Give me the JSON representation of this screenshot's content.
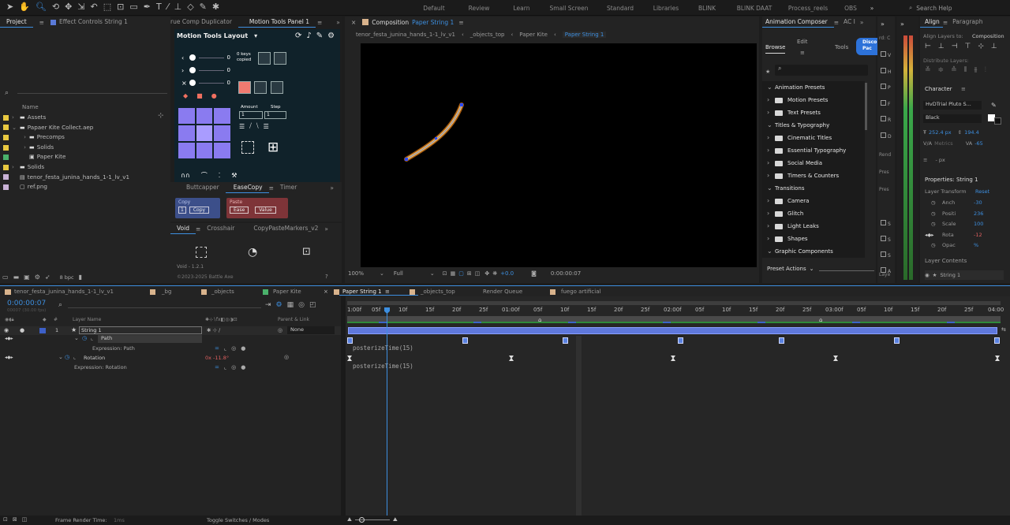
{
  "topbar": {
    "workspaces": [
      "Default",
      "Review",
      "Learn",
      "Small Screen",
      "Standard",
      "Libraries",
      "BLINK",
      "BLINK DAAT",
      "Process_reels",
      "OBS"
    ],
    "search_placeholder": "Search Help"
  },
  "project": {
    "tabs": [
      "Project",
      "Effect Controls String 1"
    ],
    "col_name": "Name",
    "items": [
      {
        "label": "Assets",
        "color": "#e8c840",
        "indent": 0,
        "type": "folder"
      },
      {
        "label": "Papaer Kite Collect.aep",
        "color": "#e8c840",
        "indent": 0,
        "type": "folder"
      },
      {
        "label": "Precomps",
        "color": "#e8c840",
        "indent": 1,
        "type": "folder"
      },
      {
        "label": "Solids",
        "color": "#e8c840",
        "indent": 1,
        "type": "folder"
      },
      {
        "label": "Paper Kite",
        "color": "#4ab16b",
        "indent": 1,
        "type": "comp"
      },
      {
        "label": "Solids",
        "color": "#e8c840",
        "indent": 0,
        "type": "folder"
      },
      {
        "label": "tenor_festa_junina_hands_1-1_lv_v1",
        "color": "#c9b2d6",
        "indent": 0,
        "type": "file"
      },
      {
        "label": "ref.png",
        "color": "#c9b2d6",
        "indent": 0,
        "type": "file"
      }
    ],
    "bpc": "8 bpc"
  },
  "mid_tabs": [
    "rue Comp Duplicator",
    "Motion Tools Panel 1"
  ],
  "motiontools": {
    "title": "Motion Tools Layout",
    "values": [
      "0",
      "0",
      "0"
    ],
    "keys_copied": "0 keys copied",
    "amount_label": "Amount",
    "step_label": "Step",
    "amount": "1",
    "step": "1"
  },
  "easecopy": {
    "tabs": [
      "Buttcapper",
      "EaseCopy",
      "Timer"
    ],
    "copy_title": "Copy",
    "paste_title": "Paste",
    "copy_num": "1",
    "copy_btn": "Copy",
    "ease_btn": "Ease",
    "value_btn": "Value"
  },
  "void": {
    "tabs": [
      "Void",
      "Crosshair",
      "CopyPasteMarkers_v2"
    ],
    "version": "Void - 1.2.1",
    "copyright": "©2023-2025 Battle Axe"
  },
  "comp": {
    "tab_label": "Composition",
    "tab_name": "Paper String 1",
    "crumbs": [
      "tenor_festa_junina_hands_1-1_lv_v1",
      "_objects_top",
      "Paper Kite",
      "Paper String 1"
    ],
    "zoom": "100%",
    "res": "Full",
    "exposure": "+0.0",
    "time": "0:00:00:07"
  },
  "composer": {
    "title": "Animation Composer",
    "tab2": "AC I",
    "browse": "Browse",
    "edit": "Edit",
    "tools": "Tools",
    "discover": "Disco Pac",
    "items": [
      {
        "label": "Animation Presets",
        "level": 0,
        "open": true
      },
      {
        "label": "Motion Presets",
        "level": 1,
        "open": false
      },
      {
        "label": "Text Presets",
        "level": 1,
        "open": false
      },
      {
        "label": "Titles & Typography",
        "level": 0,
        "open": true
      },
      {
        "label": "Cinematic Titles",
        "level": 1,
        "open": false
      },
      {
        "label": "Essential Typography",
        "level": 1,
        "open": false
      },
      {
        "label": "Social Media",
        "level": 1,
        "open": false
      },
      {
        "label": "Timers & Counters",
        "level": 1,
        "open": false
      },
      {
        "label": "Transitions",
        "level": 0,
        "open": true
      },
      {
        "label": "Camera",
        "level": 1,
        "open": false
      },
      {
        "label": "Glitch",
        "level": 1,
        "open": false
      },
      {
        "label": "Light Leaks",
        "level": 1,
        "open": false
      },
      {
        "label": "Shapes",
        "level": 1,
        "open": false
      },
      {
        "label": "Graphic Components",
        "level": 0,
        "open": true
      }
    ],
    "preset_actions": "Preset Actions"
  },
  "strip": {
    "labels": [
      "rd: C",
      "V",
      "H",
      "P",
      "F",
      "R",
      "D",
      "Rend",
      "Pres",
      "Pres",
      "S",
      "S",
      "S",
      "A",
      "Laye"
    ]
  },
  "right": {
    "align_tab": "Align",
    "para_tab": "Paragraph",
    "align_to": "Align Layers to:",
    "align_target": "Composition",
    "distribute": "Distribute Layers:",
    "character": "Character",
    "font": "HvDTrial Pluto S...",
    "style": "Black",
    "size": "252.4 px",
    "leading": "194.4",
    "metrics": "Metrics",
    "tracking": "-65",
    "px": "- px",
    "props_title": "Properties: String 1",
    "layer_transform": "Layer Transform",
    "reset": "Reset",
    "props": [
      {
        "label": "Anch",
        "value": "-30"
      },
      {
        "label": "Positi",
        "value": "236"
      },
      {
        "label": "Scale",
        "value": "100"
      },
      {
        "label": "Rota",
        "value": "-12"
      },
      {
        "label": "Opac",
        "value": "% "
      }
    ],
    "layer_contents": "Layer Contents",
    "content_item": "String 1"
  },
  "timeline": {
    "tabs": [
      "tenor_festa_junina_hands_1-1_lv_v1",
      "_bg",
      "_objects",
      "Paper Kite",
      "Paper String 1",
      "_objects_top",
      "Render Queue",
      "fuego artificial"
    ],
    "tab_colors": [
      "#d9b38c",
      "#d9b38c",
      "#d9b38c",
      "#4ab16b",
      "#d9b38c",
      "#d9b38c",
      "",
      "#d9b38c"
    ],
    "timecode": "0:00:00:07",
    "fps": "00007 (30.00 fps)",
    "col_layer": "Layer Name",
    "col_parent": "Parent & Link",
    "layer_num": "1",
    "layer_name": "String 1",
    "parent_value": "None",
    "path_label": "Path",
    "expr_path": "Expression: Path",
    "rotation_label": "Rotation",
    "rotation_value": "0x -11.8°",
    "expr_rot": "Expression: Rotation",
    "expr_code": "posterizeTime(15)",
    "ruler": [
      "1:00f",
      "05f",
      "10f",
      "15f",
      "20f",
      "25f",
      "01:00f",
      "05f",
      "10f",
      "15f",
      "20f",
      "25f",
      "02:00f",
      "05f",
      "10f",
      "15f",
      "20f",
      "25f",
      "03:00f",
      "05f",
      "10f",
      "15f",
      "20f",
      "25f",
      "04:00"
    ]
  },
  "status": {
    "render_label": "Frame Render Time:",
    "render_value": "1ms",
    "toggle": "Toggle Switches / Modes"
  }
}
